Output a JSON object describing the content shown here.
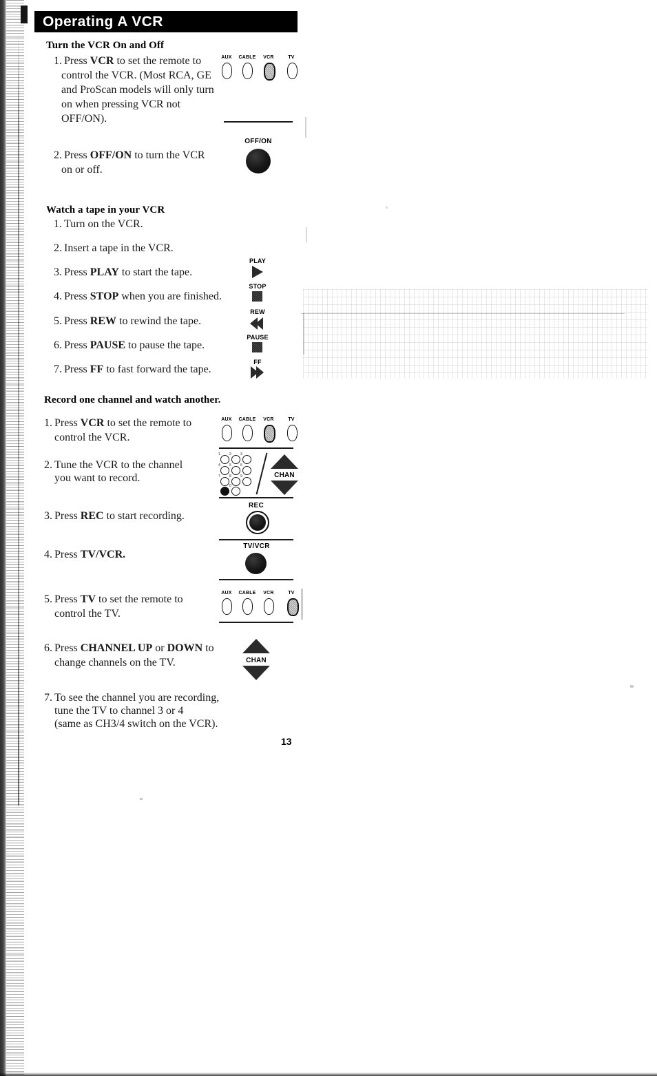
{
  "document": {
    "header_title": "Operating A VCR",
    "page_number": "13"
  },
  "sections": [
    {
      "heading": "Turn the VCR On and Off",
      "steps": [
        {
          "num": "1.",
          "lines": [
            "Press ",
            "VCR",
            " to set the remote to",
            "control the VCR. (Most RCA, GE",
            "and ProScan models will only turn",
            "on when pressing VCR not",
            "OFF/ON)."
          ]
        },
        {
          "num": "2.",
          "lines": [
            "Press ",
            "OFF/ON",
            " to turn the VCR",
            "on or off."
          ]
        }
      ]
    },
    {
      "heading": "Watch a tape in your VCR",
      "steps": [
        {
          "num": "1.",
          "text": "Turn on the VCR."
        },
        {
          "num": "2.",
          "text": "Insert a tape in the VCR."
        },
        {
          "num": "3.",
          "text": "Press PLAY to start the tape."
        },
        {
          "num": "4.",
          "text": "Press STOP when you are finished."
        },
        {
          "num": "5.",
          "text": "Press REW to rewind the tape."
        },
        {
          "num": "6.",
          "text": "Press PAUSE to pause the tape."
        },
        {
          "num": "7.",
          "text": "Press FF to fast forward the tape."
        }
      ]
    },
    {
      "heading": "Record one channel and watch another.",
      "steps": [
        {
          "num": "1.",
          "text": "Press VCR to set the remote to control the VCR."
        },
        {
          "num": "2.",
          "text": "Tune the VCR to the channel you want to record."
        },
        {
          "num": "3.",
          "text": "Press REC to start recording."
        },
        {
          "num": "4.",
          "text": "Press TV/VCR."
        },
        {
          "num": "5.",
          "text": "Press TV to set the remote to control the TV."
        },
        {
          "num": "6.",
          "text": "Press CHANNEL UP or DOWN to change channels on the TV."
        },
        {
          "num": "7.",
          "text": "To see the channel you are recording, tune the TV to channel 3 or 4 (same as CH3/4 switch on the VCR)."
        }
      ]
    }
  ],
  "text": {
    "s1_1_a": "1.",
    "s1_1_l1_pre": "Press ",
    "s1_1_l1_bold": "VCR",
    "s1_1_l1_post": " to set the remote to",
    "s1_1_l2": "control the VCR. (Most RCA, GE",
    "s1_1_l3": "and ProScan models will only turn",
    "s1_1_l4": "on when pressing VCR not",
    "s1_1_l5": "OFF/ON).",
    "s1_2_a": "2.",
    "s1_2_pre": "Press ",
    "s1_2_bold": "OFF/ON",
    "s1_2_post": " to turn the VCR",
    "s1_2_l2": "on or off.",
    "s2_1_a": "1.",
    "s2_1_t": "Turn on the VCR.",
    "s2_2_a": "2.",
    "s2_2_t": "Insert a tape in the VCR.",
    "s2_3_a": "3.",
    "s2_3_pre": "Press ",
    "s2_3_bold": "PLAY",
    "s2_3_post": " to start the tape.",
    "s2_4_a": "4.",
    "s2_4_pre": "Press ",
    "s2_4_bold": "STOP",
    "s2_4_post": " when you are finished.",
    "s2_5_a": "5.",
    "s2_5_pre": "Press ",
    "s2_5_bold": "REW",
    "s2_5_post": " to rewind the tape.",
    "s2_6_a": "6.",
    "s2_6_pre": "Press ",
    "s2_6_bold": "PAUSE",
    "s2_6_post": " to pause the tape.",
    "s2_7_a": "7.",
    "s2_7_pre": "Press ",
    "s2_7_bold": "FF",
    "s2_7_post": " to fast forward the tape.",
    "s3_1_a": "1.",
    "s3_1_pre": "Press ",
    "s3_1_bold": "VCR",
    "s3_1_post": " to set the remote to",
    "s3_1_l2": "control the VCR.",
    "s3_2_a": "2.",
    "s3_2_l1": "Tune the VCR to the channel",
    "s3_2_l2": "you want to record.",
    "s3_3_a": "3.",
    "s3_3_pre": "Press ",
    "s3_3_bold": "REC",
    "s3_3_post": " to start recording.",
    "s3_4_a": "4.",
    "s3_4_pre": "Press ",
    "s3_4_bold": "TV/VCR.",
    "s3_5_a": "5.",
    "s3_5_pre": "Press ",
    "s3_5_bold": "TV",
    "s3_5_post": " to set the remote to",
    "s3_5_l2": "control the TV.",
    "s3_6_a": "6.",
    "s3_6_pre": "Press ",
    "s3_6_bold": "CHANNEL UP",
    "s3_6_mid": " or ",
    "s3_6_bold2": "DOWN",
    "s3_6_post": " to",
    "s3_6_l2": "change channels on the TV.",
    "s3_7_a": "7.",
    "s3_7_l1": "To see the channel you are recording,",
    "s3_7_l2": "tune the TV to channel 3 or 4",
    "s3_7_l3": "(same as CH3/4 switch on the VCR)."
  },
  "graphics": {
    "mode_row_1": {
      "labels": [
        "AUX",
        "CABLE",
        "VCR",
        "TV"
      ],
      "selected": "VCR"
    },
    "mode_row_2": {
      "labels": [
        "AUX",
        "CABLE",
        "VCR",
        "TV"
      ],
      "selected": "VCR"
    },
    "mode_row_3": {
      "labels": [
        "AUX",
        "CABLE",
        "VCR",
        "TV"
      ],
      "selected": "TV"
    },
    "offon_button": {
      "label": "OFF/ON"
    },
    "transport": [
      {
        "label": "PLAY",
        "icon": "play-triangle-icon"
      },
      {
        "label": "STOP",
        "icon": "stop-square-icon"
      },
      {
        "label": "REW",
        "icon": "rewind-chevron-icon"
      },
      {
        "label": "PAUSE",
        "icon": "pause-square-icon"
      },
      {
        "label": "FF",
        "icon": "fast-forward-chevron-icon"
      }
    ],
    "keypad": {
      "keys": [
        "1",
        "2",
        "3",
        "4",
        "5",
        "6",
        "7",
        "8",
        "9",
        "0"
      ],
      "chan_label": "CHAN"
    },
    "rec_button": {
      "label": "REC"
    },
    "tvvcr_button": {
      "label": "TV/VCR"
    },
    "chan_bottom": {
      "label": "CHAN"
    }
  },
  "colors": {
    "ink": "#111111",
    "header_bg": "#000000",
    "header_fg": "#ffffff",
    "paper": "#ffffff"
  }
}
